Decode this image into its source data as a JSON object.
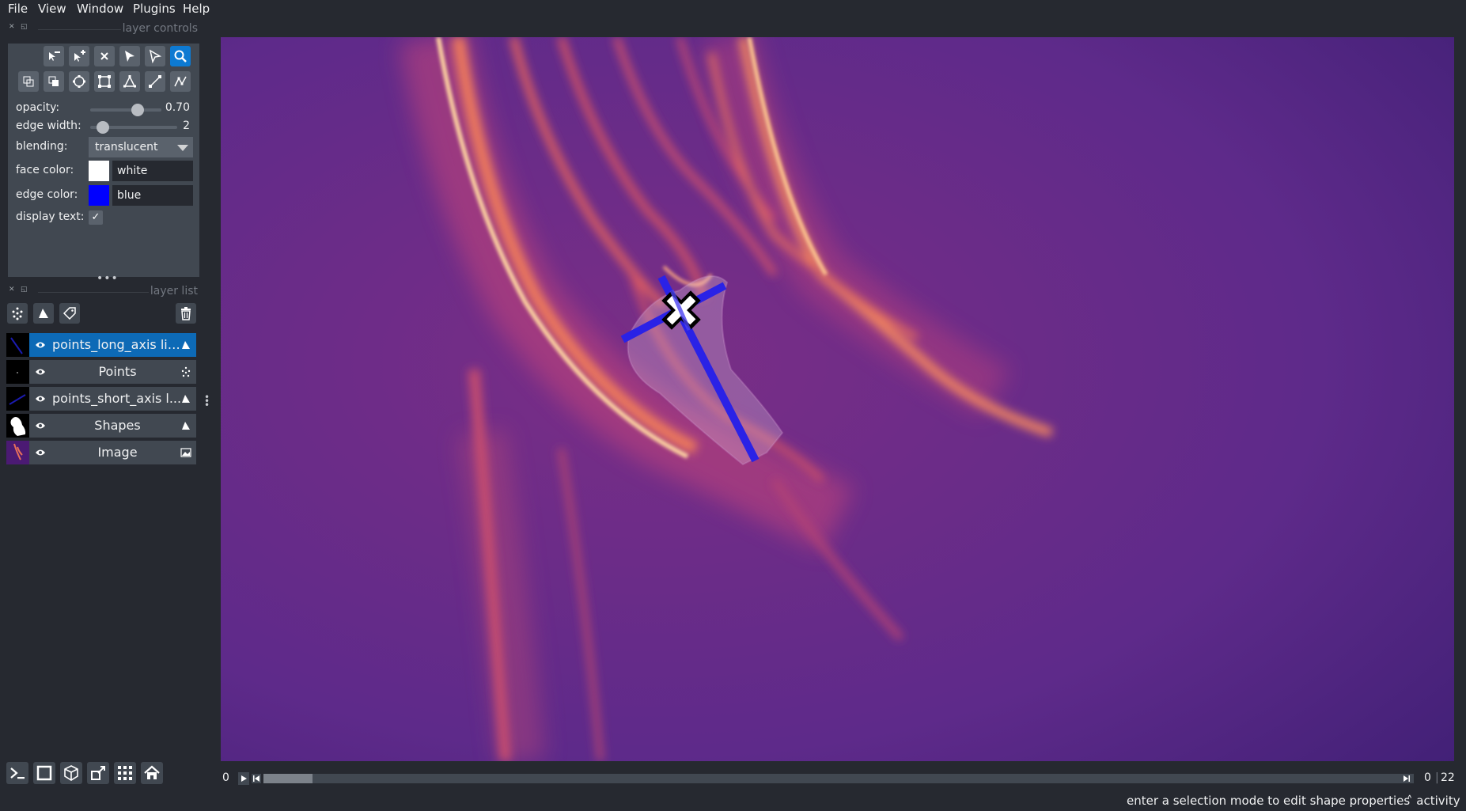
{
  "menu": [
    "File",
    "View",
    "Window",
    "Plugins",
    "Help"
  ],
  "layer_controls": {
    "title": "layer controls",
    "opacity": {
      "label": "opacity:",
      "value": "0.70",
      "fraction": 0.7
    },
    "edge_width": {
      "label": "edge width:",
      "value": "2",
      "fraction": 0.08
    },
    "blending": {
      "label": "blending:",
      "value": "translucent"
    },
    "face_color": {
      "label": "face color:",
      "value": "white",
      "swatch": "#ffffff"
    },
    "edge_color": {
      "label": "edge color:",
      "value": "blue",
      "swatch": "#0000ff"
    },
    "display_text": {
      "label": "display text:",
      "checked": true
    }
  },
  "layer_list": {
    "title": "layer list",
    "layers": [
      {
        "name": "points_long_axis line",
        "type": "shapes",
        "selected": true
      },
      {
        "name": "Points",
        "type": "points",
        "selected": false
      },
      {
        "name": "points_short_axis l...",
        "type": "shapes",
        "selected": false
      },
      {
        "name": "Shapes",
        "type": "shapes",
        "selected": false
      },
      {
        "name": "Image",
        "type": "image",
        "selected": false
      }
    ]
  },
  "dims": {
    "current": "0",
    "left_value": "0",
    "max": "22"
  },
  "status": {
    "message": "enter a selection mode to edit shape properties",
    "activity": "activity"
  },
  "colors": {
    "accent": "#0d7ad2",
    "panel": "#414851",
    "background": "#262930"
  }
}
